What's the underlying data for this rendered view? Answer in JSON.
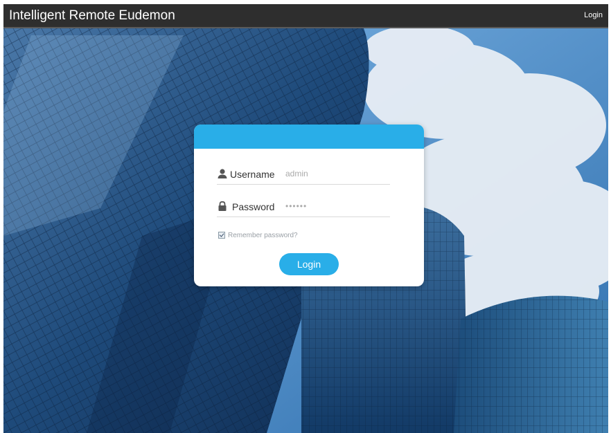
{
  "app": {
    "title": "Intelligent Remote Eudemon",
    "top_login_label": "Login"
  },
  "login_form": {
    "username_label": "Username",
    "username_value": "admin",
    "password_label": "Password",
    "password_value": "••••••",
    "remember_label": "Remember password?",
    "remember_checked": true,
    "submit_label": "Login"
  },
  "icons": {
    "username": "user-icon",
    "password": "lock-icon"
  },
  "colors": {
    "topbar": "#2e2e2e",
    "accent": "#29aee8",
    "card_bg": "#ffffff"
  }
}
